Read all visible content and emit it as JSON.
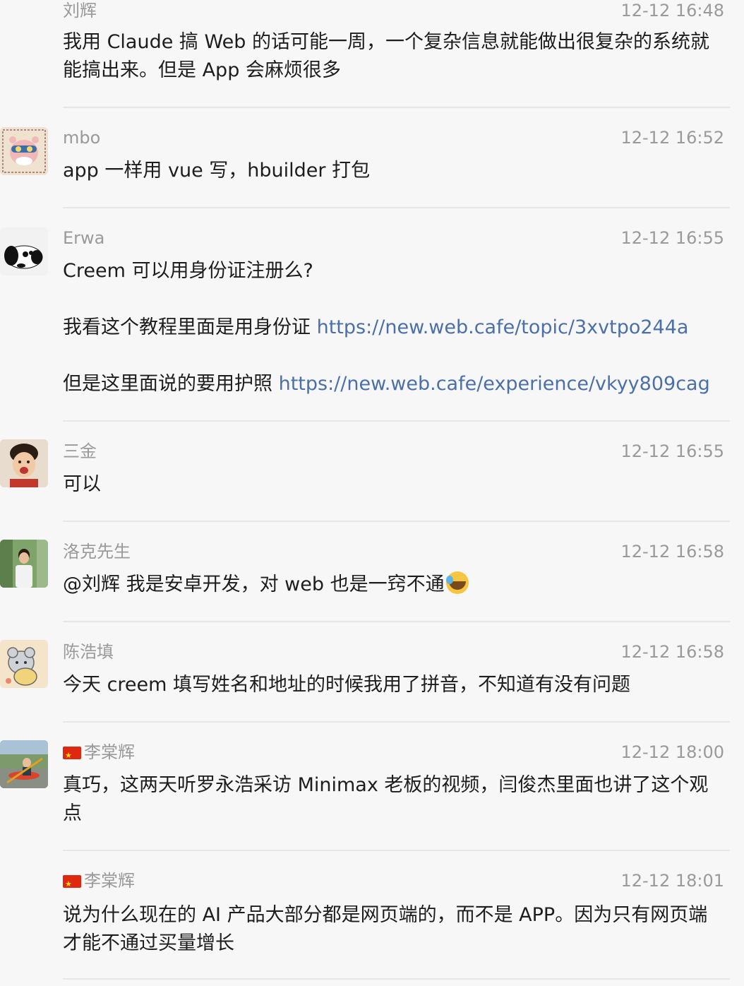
{
  "messages": [
    {
      "sender": "刘辉",
      "time": "12-12 16:48",
      "text": "我用 Claude 搞 Web 的话可能一周，一个复杂信息就能做出很复杂的系统就能搞出来。但是 App 会麻烦很多"
    },
    {
      "sender": "mbo",
      "time": "12-12 16:52",
      "text": "app 一样用 vue 写，hbuilder 打包"
    },
    {
      "sender": "Erwa",
      "time": "12-12 16:55",
      "line1": "Creem 可以用身份证注册么?",
      "line2_prefix": "我看这个教程里面是用身份证 ",
      "line2_link": "https://new.web.cafe/topic/3xvtpo244a",
      "line3_prefix": "但是这里面说的要用护照 ",
      "line3_link": "https://new.web.cafe/experience/vkyy809cag"
    },
    {
      "sender": "三金",
      "time": "12-12 16:55",
      "text": "可以"
    },
    {
      "sender": "洛克先生",
      "time": "12-12 16:58",
      "text": "@刘辉 我是安卓开发，对 web 也是一窍不通",
      "emoji": "rolling-on-floor-laughing-emoji"
    },
    {
      "sender": "陈浩填",
      "time": "12-12 16:58",
      "text": "今天 creem 填写姓名和地址的时候我用了拼音，不知道有没有问题"
    },
    {
      "sender": "李棠辉",
      "flag": "china-flag-icon",
      "time": "12-12 18:00",
      "text": "真巧，这两天听罗永浩采访 Minimax 老板的视频，闫俊杰里面也讲了这个观点"
    },
    {
      "sender": "李棠辉",
      "flag": "china-flag-icon",
      "time": "12-12 18:01",
      "text": "说为什么现在的 AI 产品大部分都是网页端的，而不是 APP。因为只有网页端才能不通过买量增长"
    }
  ]
}
